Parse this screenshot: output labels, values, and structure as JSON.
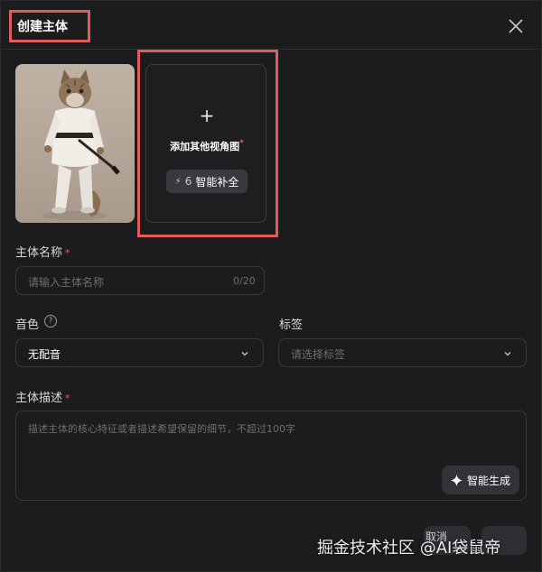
{
  "dialog": {
    "title": "创建主体"
  },
  "views": {
    "add_label": "添加其他视角图",
    "add_required": "*",
    "smart_fill_cost": "6",
    "smart_fill_label": "智能补全"
  },
  "name_field": {
    "label": "主体名称",
    "required": "*",
    "placeholder": "请输入主体名称",
    "counter": "0/20"
  },
  "voice_field": {
    "label": "音色",
    "value": "无配音"
  },
  "tags_field": {
    "label": "标签",
    "placeholder": "请选择标签"
  },
  "desc_field": {
    "label": "主体描述",
    "required": "*",
    "placeholder": "描述主体的核心特征或者描述希望保留的细节，不超过100字",
    "generate_label": "智能生成"
  },
  "footer": {
    "cancel_label": "取消"
  },
  "watermark": "掘金技术社区 @AI袋鼠帝",
  "colors": {
    "highlight": "#e35c5c",
    "background": "#1c1c1e",
    "button": "#333337"
  }
}
